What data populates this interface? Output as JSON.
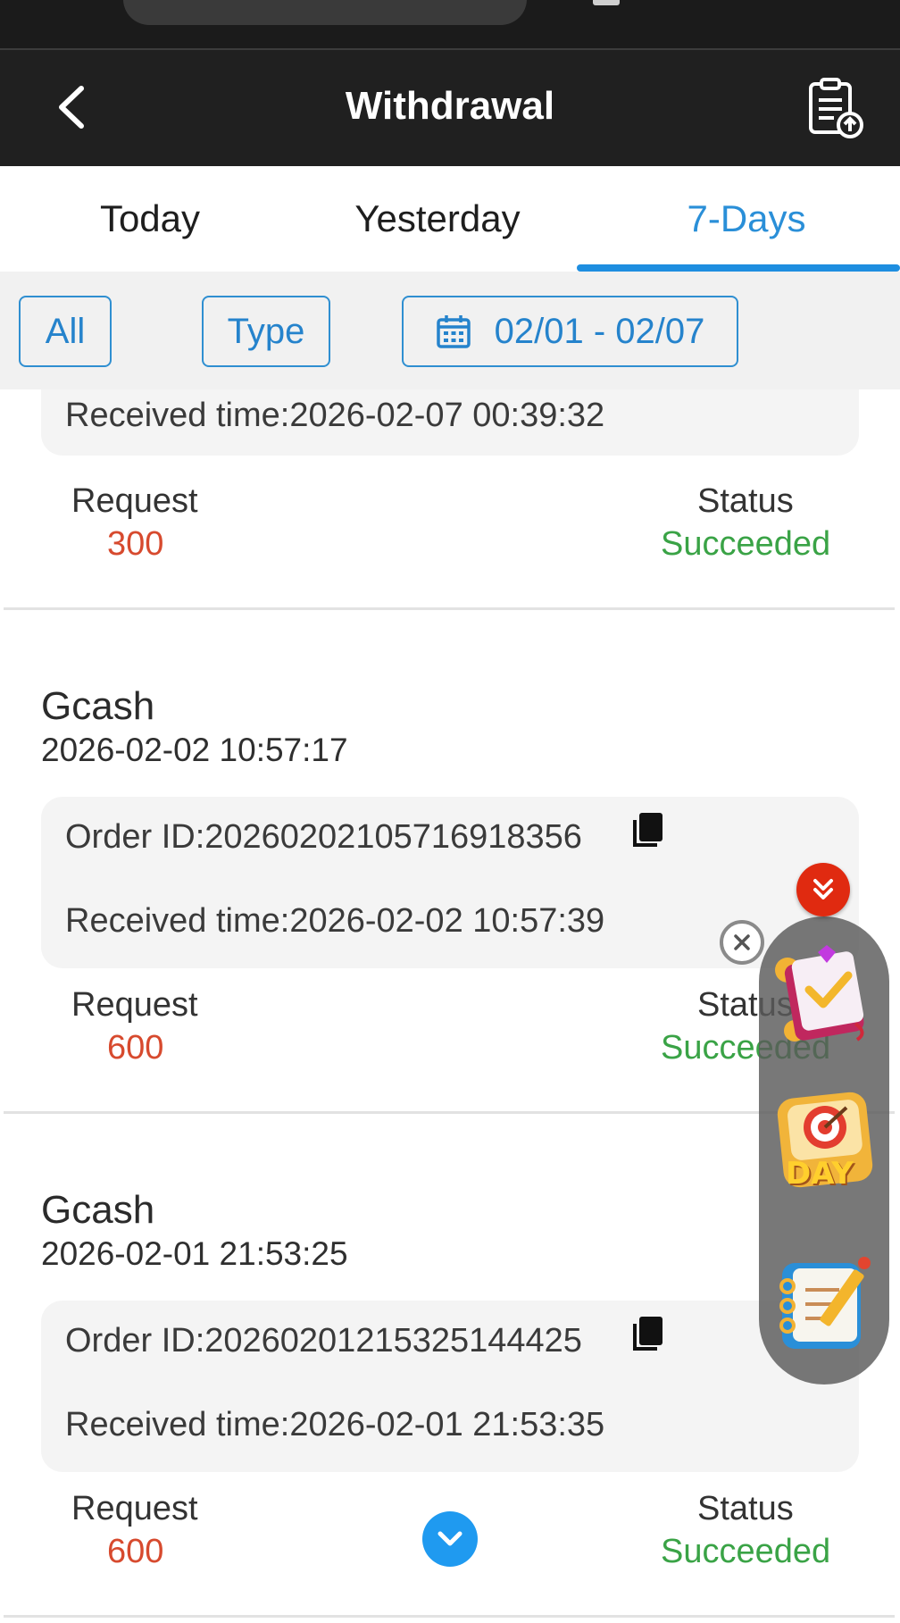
{
  "header": {
    "title": "Withdrawal"
  },
  "tabs": [
    {
      "label": "Today"
    },
    {
      "label": "Yesterday"
    },
    {
      "label": "7-Days"
    }
  ],
  "filters": {
    "all": "All",
    "type": "Type",
    "date_range": "02/01 - 02/07"
  },
  "labels": {
    "request": "Request",
    "status": "Status"
  },
  "records": [
    {
      "received": "Received time:2026-02-07 00:39:32",
      "amount": "300",
      "status": "Succeeded"
    },
    {
      "method": "Gcash",
      "datetime": "2026-02-02 10:57:17",
      "order": "Order ID:20260202105716918356",
      "received": "Received time:2026-02-02 10:57:39",
      "amount": "600",
      "status": "Succeeded"
    },
    {
      "method": "Gcash",
      "datetime": "2026-02-01 21:53:25",
      "order": "Order ID:20260201215325144425",
      "received": "Received time:2026-02-01 21:53:35",
      "amount": "600",
      "status": "Succeeded"
    }
  ],
  "floating": {
    "day_badge": "DAY"
  },
  "colors": {
    "accent": "#1e8ee0",
    "amount": "#d74a2e",
    "success": "#3aa346",
    "header_bg": "#202020"
  },
  "icons": [
    "back-arrow-icon",
    "report-clipboard-icon",
    "calendar-icon",
    "copy-icon",
    "close-icon",
    "double-chevron-down-icon",
    "chevron-down-icon"
  ]
}
